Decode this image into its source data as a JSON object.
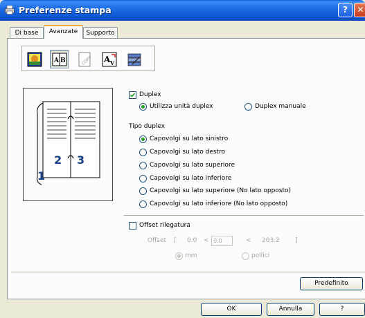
{
  "window": {
    "title": "Preferenze stampa",
    "help_label": "?",
    "close_label": "✕"
  },
  "tabs": [
    {
      "label": "Di base"
    },
    {
      "label": "Avanzate"
    },
    {
      "label": "Supporto"
    }
  ],
  "toolbar_icons": [
    "print-quality-icon",
    "duplex-icon",
    "watermark-icon",
    "page-setting-icon",
    "device-options-icon"
  ],
  "preview": {
    "page_numbers": [
      "1",
      "2",
      "3"
    ]
  },
  "duplex": {
    "label": "Duplex",
    "checked": true,
    "mode_options": [
      {
        "label": "Utilizza unità duplex",
        "selected": true
      },
      {
        "label": "Duplex manuale",
        "selected": false
      }
    ]
  },
  "duplex_type": {
    "title": "Tipo duplex",
    "options": [
      {
        "label": "Capovolgi su lato sinistro",
        "selected": true
      },
      {
        "label": "Capovolgi su lato destro",
        "selected": false
      },
      {
        "label": "Capovolgi su lato superiore",
        "selected": false
      },
      {
        "label": "Capovolgi su lato inferiore",
        "selected": false
      },
      {
        "label": "Capovolgi su lato superiore (No lato opposto)",
        "selected": false
      },
      {
        "label": "Capovolgi su lato inferiore (No lato opposto)",
        "selected": false
      }
    ]
  },
  "binding_offset": {
    "label": "Offset rilegatura",
    "checked": false,
    "offset_label": "Offset",
    "bracket_open": "[",
    "min": "0.0",
    "lt1": "<",
    "value": "0.0",
    "lt2": "<",
    "max": "203.2",
    "bracket_close": "]",
    "units": [
      {
        "label": "mm",
        "selected": true
      },
      {
        "label": "pollici",
        "selected": false
      }
    ]
  },
  "buttons": {
    "default": "Predefinito",
    "ok": "OK",
    "cancel": "Annulla",
    "help": "?"
  },
  "colors": {
    "titlebar": "#0b53d1",
    "dialog": "#ece9d8",
    "radio_dot": "#21a121",
    "active_tab_accent": "#f2a93b"
  }
}
